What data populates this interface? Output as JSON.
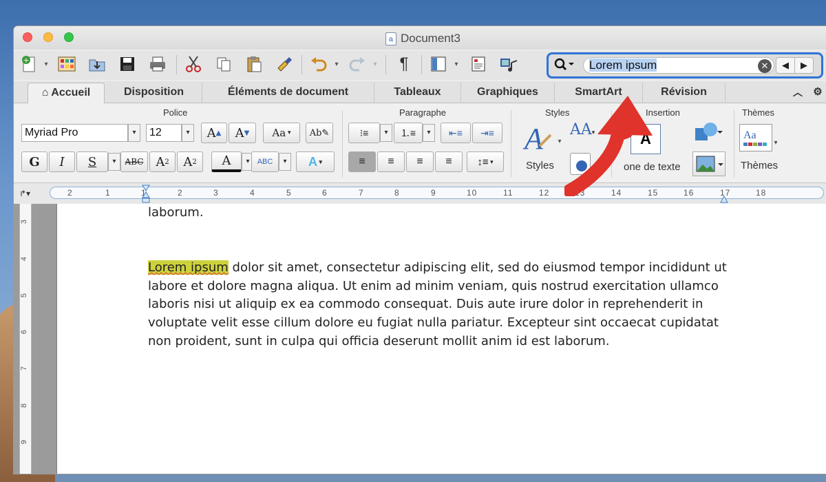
{
  "window": {
    "title": "Document3"
  },
  "search": {
    "value": "Lorem ipsum"
  },
  "tabs": [
    {
      "label": "Accueil"
    },
    {
      "label": "Disposition"
    },
    {
      "label": "Éléments de document"
    },
    {
      "label": "Tableaux"
    },
    {
      "label": "Graphiques"
    },
    {
      "label": "SmartArt"
    },
    {
      "label": "Révision"
    }
  ],
  "ribbon": {
    "police_title": "Police",
    "paragraphe_title": "Paragraphe",
    "styles_title": "Styles",
    "insertion_title": "Insertion",
    "themes_title": "Thèmes",
    "font_name": "Myriad Pro",
    "font_size": "12",
    "styles_label": "Styles",
    "textbox_label": "one de texte",
    "themes_label": "Thèmes"
  },
  "ruler": {
    "numbers": [
      "2",
      "1",
      "1",
      "2",
      "3",
      "4",
      "5",
      "6",
      "7",
      "8",
      "9",
      "10",
      "11",
      "12",
      "13",
      "14",
      "15",
      "16",
      "17",
      "18"
    ]
  },
  "vruler": {
    "numbers": [
      "3",
      "4",
      "5",
      "6",
      "7",
      "8",
      "9"
    ]
  },
  "document": {
    "prev_line": "laborum.",
    "highlight": "Lorem ipsum",
    "paragraph_rest": " dolor sit amet, consectetur adipiscing elit, sed do eiusmod tempor incididunt ut labore et dolore magna aliqua. Ut enim ad minim veniam, quis nostrud exercitation ullamco laboris nisi ut aliquip ex ea commodo consequat. Duis aute irure dolor in reprehenderit in voluptate velit esse cillum dolore eu fugiat nulla pariatur. Excepteur sint occaecat cupidatat non proident, sunt in culpa qui officia deserunt mollit anim id est laborum."
  },
  "colors": {
    "accent": "#2f72d8",
    "highlight": "#cdd23c",
    "arrow": "#e0332b"
  }
}
